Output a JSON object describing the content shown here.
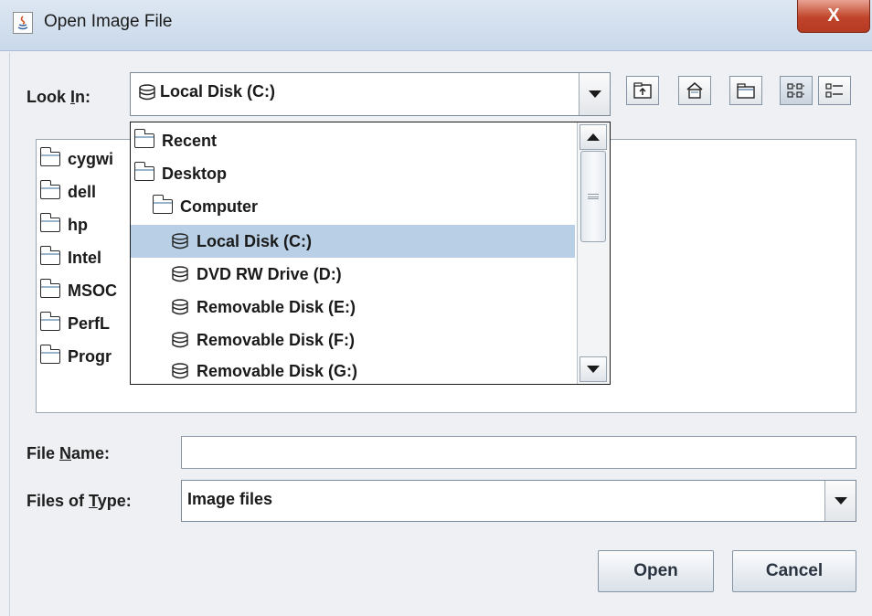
{
  "window": {
    "title": "Open Image File",
    "close_label": "X"
  },
  "look_in": {
    "label_pre": "Look ",
    "label_mnemonic": "I",
    "label_post": "n:",
    "value": "Local Disk (C:)"
  },
  "toolbar": {
    "icons": [
      "up-one-level-icon",
      "home-icon",
      "new-folder-icon",
      "list-view-icon",
      "details-view-icon"
    ]
  },
  "file_list": {
    "items": [
      "cygwi",
      "dell",
      "hp",
      "Intel",
      "MSOC",
      "PerfL",
      "Progr"
    ]
  },
  "look_in_dropdown": {
    "items": [
      {
        "label": "Recent",
        "icon": "folder-icon",
        "indent": 0
      },
      {
        "label": "Desktop",
        "icon": "folder-icon",
        "indent": 0
      },
      {
        "label": "Computer",
        "icon": "folder-icon",
        "indent": 1
      },
      {
        "label": "Local Disk (C:)",
        "icon": "disk-icon",
        "indent": 2,
        "selected": true
      },
      {
        "label": "DVD RW Drive (D:)",
        "icon": "disk-icon",
        "indent": 2
      },
      {
        "label": "Removable Disk (E:)",
        "icon": "disk-icon",
        "indent": 2
      },
      {
        "label": "Removable Disk (F:)",
        "icon": "disk-icon",
        "indent": 2
      },
      {
        "label": "Removable Disk (G:)",
        "icon": "disk-icon",
        "indent": 2
      }
    ]
  },
  "file_name": {
    "label_pre": "File ",
    "label_mnemonic": "N",
    "label_post": "ame:",
    "value": ""
  },
  "files_of_type": {
    "label_pre": "Files of ",
    "label_mnemonic": "T",
    "label_post": "ype:",
    "value": "Image files"
  },
  "buttons": {
    "open": "Open",
    "cancel": "Cancel"
  },
  "colors": {
    "selection": "#b8cfe5",
    "title_bar": "#c9d8ea",
    "close_button": "#c0442a"
  }
}
